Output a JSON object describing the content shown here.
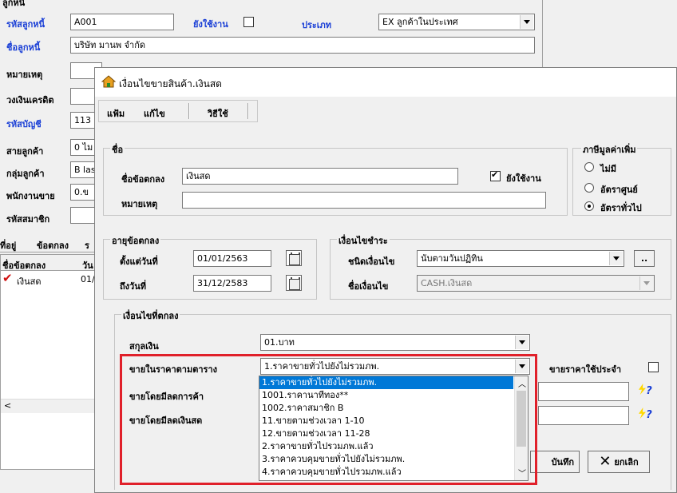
{
  "bg_form": {
    "title_partial": "ลูกหนี้",
    "code_label": "รหัสลูกหนี้",
    "code_value": "A001",
    "active_label": "ยังใช้งาน",
    "type_label": "ประเภท",
    "type_value": "EX ลูกค้าในประเทศ",
    "name_label": "ชื่อลูกหนี้",
    "name_value": "บริษัท มานพ จำกัด",
    "note_label": "หมายเหตุ",
    "credit_label": "วงเงินเครดิต",
    "account_label": "รหัสบัญชี",
    "account_value": "113",
    "line_label": "สายลูกค้า",
    "line_value": "0 ไม",
    "group_label": "กลุ่มลูกค้า",
    "group_value": "B las",
    "salesman_label": "พนักงานขาย",
    "salesman_value": "0.ข",
    "member_label": "รหัสสมาชิก",
    "tabs": [
      "ที่อยู่",
      "ข้อตกลง",
      "ร"
    ],
    "grid_headers": [
      "ชื่อข้อตกลง",
      "วัน"
    ],
    "grid_rows": [
      {
        "name": "เงินสด",
        "date": "01/"
      }
    ]
  },
  "dialog": {
    "title": "เงื่อนไขขายสินค้า.เงินสด",
    "menu": [
      "แฟ้ม",
      "แก้ไข",
      "วิธีใช้"
    ],
    "name_group": "ชื่อ",
    "agreement_name_label": "ชื่อข้อตกลง",
    "agreement_name_value": "เงินสด",
    "active_label": "ยังใช้งาน",
    "note_label": "หมายเหตุ",
    "vat_group": "ภาษีมูลค่าเพิ่ม",
    "vat_options": [
      "ไม่มี",
      "อัตราศูนย์",
      "อัตราทั่วไป"
    ],
    "vat_selected_index": 2,
    "term_group": "อายุข้อตกลง",
    "from_label": "ตั้งแต่วันที่",
    "from_value": "01/01/2563",
    "to_label": "ถึงวันที่",
    "to_value": "31/12/2583",
    "payment_group": "เงื่อนไขชำระ",
    "payment_type_label": "ชนิดเงื่อนไข",
    "payment_type_value": "นับตามวันปฏิทิน",
    "more_button": "..",
    "payment_name_label": "ชื่อเงื่อนไข",
    "payment_name_value": "CASH.เงินสด",
    "agreed_group": "เงื่อนไขที่ตกลง",
    "currency_label": "สกุลเงิน",
    "currency_value": "01.บาท",
    "price_table_label": "ขายในราคาตามตาราง",
    "price_table_value": "1.ราคาขายทั่วไปยังไม่รวมภพ.",
    "fixed_price_label": "ขายราคาใช้ประจำ",
    "trade_discount_label": "ขายโดยมีลดการค้า",
    "cash_discount_label": "ขายโดยมีลดเงินสด",
    "save_button": "บันทึก",
    "cancel_button": "ยกเลิก",
    "dropdown_options": [
      "1.ราคาขายทั่วไปยังไม่รวมภพ.",
      "1001.ราคานาทีทอง**",
      "1002.ราคาสมาชิก B",
      "11.ขายตามช่วงเวลา 1-10",
      "12.ขายตามช่วงเวลา 11-28",
      "2.ราคาขายทั่วไปรวมภพ.แล้ว",
      "3.ราคาควบคุมขายทั่วไปยังไม่รวมภพ.",
      "4.ราคาควบคุมขายทั่วไปรวมภพ.แล้ว"
    ],
    "dropdown_selected_index": 0
  },
  "colors": {
    "accent_blue": "#1a3fd6",
    "selection": "#0078d7",
    "highlight_red": "#e0202a"
  }
}
